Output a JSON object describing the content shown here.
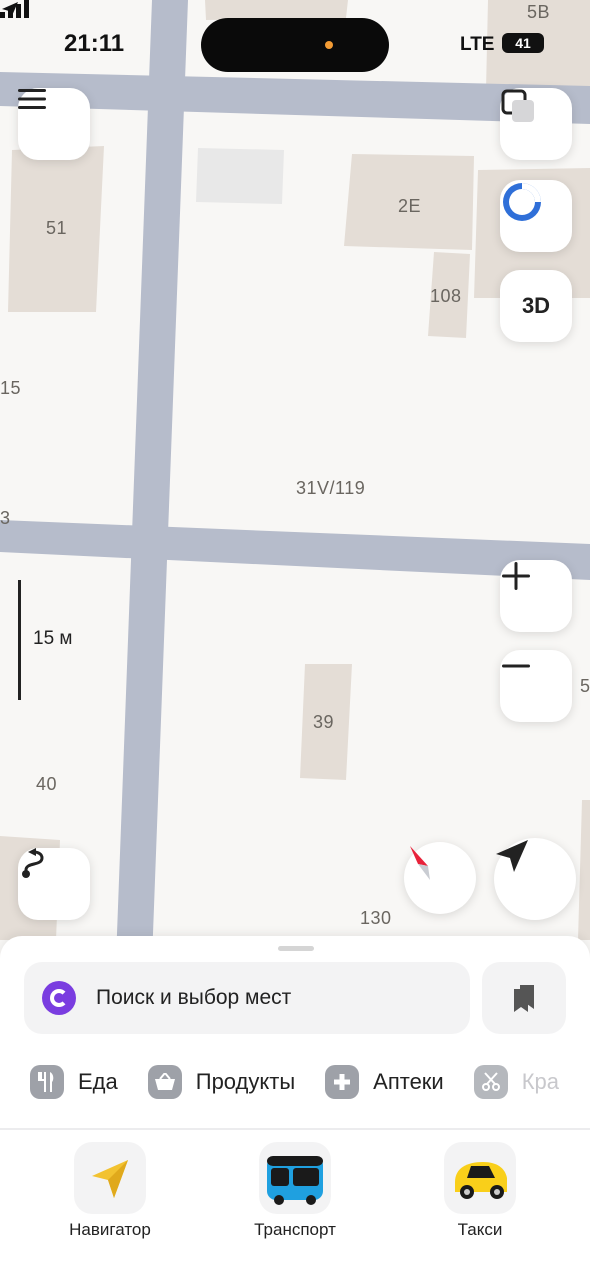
{
  "status": {
    "time": "21:11",
    "network": "LTE",
    "battery": "41"
  },
  "map": {
    "labels": {
      "b5b": "5B",
      "b51": "51",
      "b2e": "2E",
      "b108": "108",
      "b15": "15",
      "b31v": "31V/119",
      "b3": "3",
      "b39": "39",
      "b40": "40",
      "b130": "130",
      "b5": "5"
    },
    "scale": "15 м",
    "btn_3d": "3D"
  },
  "search": {
    "placeholder": "Поиск и выбор мест"
  },
  "categories": [
    {
      "label": "Еда",
      "icon": "fork-knife-icon"
    },
    {
      "label": "Продукты",
      "icon": "basket-icon"
    },
    {
      "label": "Аптеки",
      "icon": "plus-cross-icon"
    },
    {
      "label": "Кра",
      "icon": "scissors-icon"
    }
  ],
  "tabs": [
    {
      "label": "Навигатор",
      "icon": "navigator-arrow-icon"
    },
    {
      "label": "Транспорт",
      "icon": "bus-icon"
    },
    {
      "label": "Такси",
      "icon": "taxi-car-icon"
    }
  ],
  "colors": {
    "road": "#b6bccb",
    "building": "#e4ddd6",
    "accent_purple": "#7a3de0",
    "taxi_yellow": "#f9cf1a",
    "bus_blue": "#1fa0e0"
  }
}
